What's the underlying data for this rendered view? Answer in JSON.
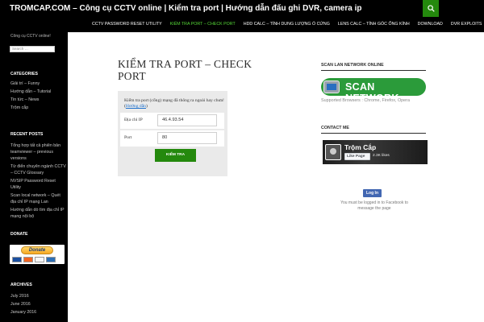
{
  "header": {
    "site_title": "TROMCAP.COM – Công cụ CCTV online | Kiểm tra port | Hướng dẫn đấu ghi DVR, camera ip",
    "search_icon": "search-icon",
    "accent_color": "#24890d"
  },
  "nav": {
    "items": [
      {
        "label": "CCTV Password Reset Utility"
      },
      {
        "label": "Kiểm tra Port – Check Port"
      },
      {
        "label": "HDD Calc – Tính dung lượng ổ cứng"
      },
      {
        "label": "Lens Calc – Tính góc ống kính"
      },
      {
        "label": "Download"
      },
      {
        "label": "DVR Exploits"
      }
    ],
    "active_color": "#55d737"
  },
  "sidebar": {
    "tagline": "Công cụ CCTV online!",
    "search_placeholder": "Search …",
    "categories_title": "Categories",
    "categories": [
      "Giải trí – Funny",
      "Hướng dẫn – Tutorial",
      "Tin tức – News",
      "Trộm cắp"
    ],
    "recent_title": "Recent Posts",
    "recent_posts": [
      "Tổng hợp tất cả phiên bản teamviewer – previous versions",
      "Từ điển chuyên ngành CCTV – CCTV Glossary",
      "NVSIP Password Reset Utility",
      "Scan local network – Quét địa chỉ IP mạng Lan",
      "Hướng dẫn dò tìm địa chỉ IP mạng nội bộ"
    ],
    "donate_title": "Donate",
    "donate_label": "Donate",
    "archives_title": "Archives",
    "archives": [
      "July 2016",
      "June 2016",
      "January 2016"
    ]
  },
  "main": {
    "page_title": "Kiểm tra port – Check port",
    "note_text": "Kiểm tra port (cổng) mạng đã thông ra ngoài hay chưa! (",
    "note_link": "Hướng dẫn",
    "note_end": ")",
    "ip_label": "Địa chỉ IP",
    "ip_value": "46.4.93.54",
    "port_label": "Port",
    "port_value": "80",
    "check_button": "Kiểm tra"
  },
  "right": {
    "scan_title": "Scan Lan Network Online",
    "scan_banner_text": "SCAN NETWORK",
    "supported": "Supported Browsers : Chrome, Firefox, Opera",
    "contact_title": "Contact Me",
    "fb_page_name": "Trộm Cắp",
    "fb_like_label": "Like Page",
    "fb_likes": "2.3K likes",
    "fb_login_label": "Log In",
    "fb_message": "You must be logged in to Facebook to message the page"
  }
}
